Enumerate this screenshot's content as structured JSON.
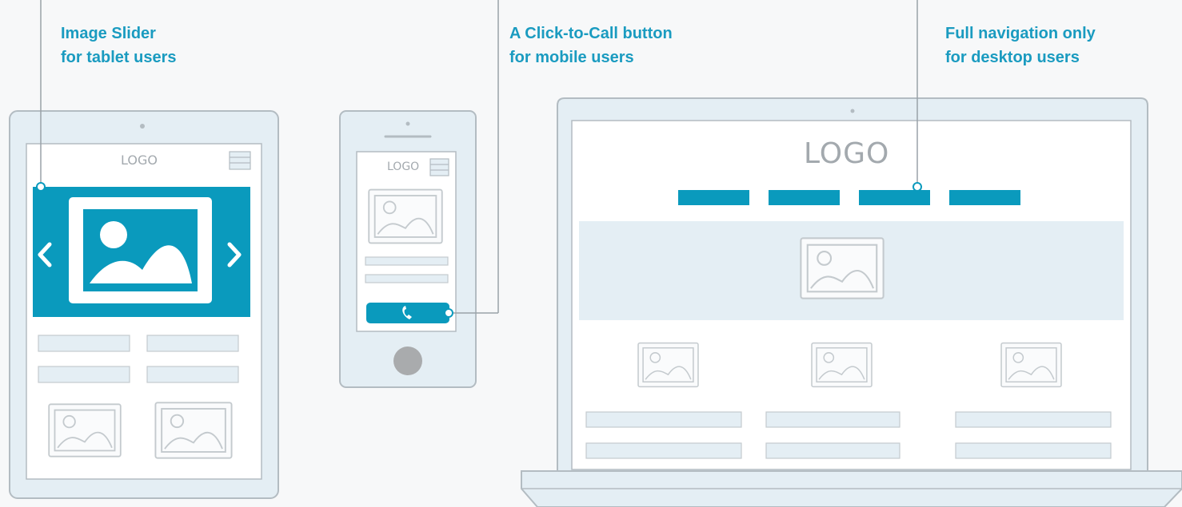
{
  "captions": {
    "tablet": {
      "line1": "Image Slider",
      "line2": "for tablet users"
    },
    "mobile": {
      "line1": "A Click-to-Call button",
      "line2": "for mobile users"
    },
    "desktop": {
      "line1": "Full navigation only",
      "line2": "for desktop users"
    }
  },
  "logos": {
    "tablet": "LOGO",
    "mobile": "LOGO",
    "desktop": "LOGO"
  },
  "colors": {
    "accent": "#0a9abd",
    "caption": "#1a9bc0",
    "device_fill": "#e4eef4",
    "outline": "#b3bcc2",
    "screen": "#ffffff",
    "background": "#f7f8f9"
  },
  "icons": {
    "slider_prev": "chevron-left-icon",
    "slider_next": "chevron-right-icon",
    "call": "phone-icon",
    "menu": "hamburger-menu-icon",
    "image": "image-placeholder-icon"
  }
}
